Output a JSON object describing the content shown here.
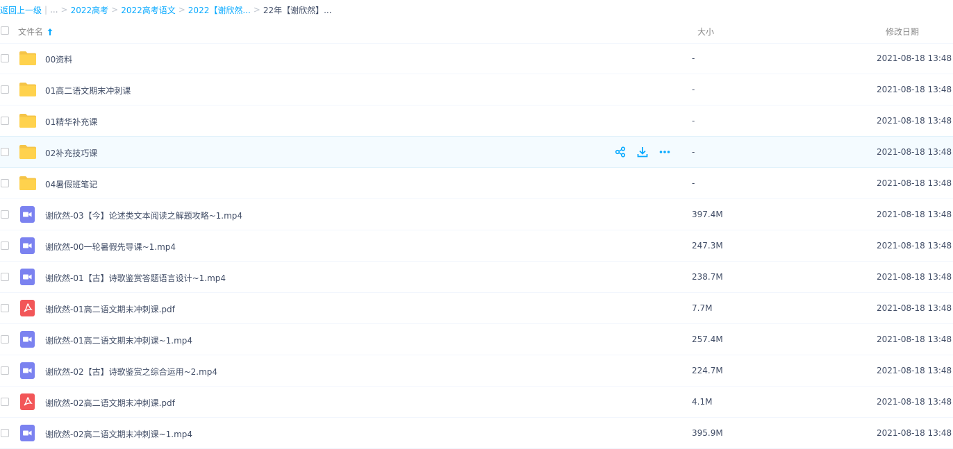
{
  "breadcrumb": {
    "back": "返回上一级",
    "ellipsis": "...",
    "crumbs": [
      "2022高考",
      "2022高考语文",
      "2022【谢欣然..."
    ],
    "current": "22年【谢欣然】..."
  },
  "header": {
    "name": "文件名",
    "size": "大小",
    "date": "修改日期"
  },
  "colors": {
    "accent": "#09aaff",
    "folder": "#ffd24d",
    "video": "#7b82f0",
    "pdf": "#f25658"
  },
  "files": [
    {
      "name": "00资料",
      "type": "folder",
      "size": "-",
      "date": "2021-08-18 13:48"
    },
    {
      "name": "01高二语文期末冲刺课",
      "type": "folder",
      "size": "-",
      "date": "2021-08-18 13:48"
    },
    {
      "name": "01精华补充课",
      "type": "folder",
      "size": "-",
      "date": "2021-08-18 13:48"
    },
    {
      "name": "02补充技巧课",
      "type": "folder",
      "size": "-",
      "date": "2021-08-18 13:48"
    },
    {
      "name": "04暑假班笔记",
      "type": "folder",
      "size": "-",
      "date": "2021-08-18 13:48"
    },
    {
      "name": " 谢欣然-03【今】论述类文本阅读之解题攻略~1.mp4",
      "type": "video",
      "size": "397.4M",
      "date": "2021-08-18 13:48"
    },
    {
      "name": "谢欣然-00一轮暑假先导课~1.mp4",
      "type": "video",
      "size": "247.3M",
      "date": "2021-08-18 13:48"
    },
    {
      "name": "谢欣然-01【古】诗歌鉴赏答题语言设计~1.mp4",
      "type": "video",
      "size": "238.7M",
      "date": "2021-08-18 13:48"
    },
    {
      "name": "谢欣然-01高二语文期末冲刺课.pdf",
      "type": "pdf",
      "size": "7.7M",
      "date": "2021-08-18 13:48"
    },
    {
      "name": "谢欣然-01高二语文期末冲刺课~1.mp4",
      "type": "video",
      "size": "257.4M",
      "date": "2021-08-18 13:48"
    },
    {
      "name": "谢欣然-02【古】诗歌鉴赏之综合运用~2.mp4",
      "type": "video",
      "size": "224.7M",
      "date": "2021-08-18 13:48"
    },
    {
      "name": "谢欣然-02高二语文期末冲刺课.pdf",
      "type": "pdf",
      "size": "4.1M",
      "date": "2021-08-18 13:48"
    },
    {
      "name": "谢欣然-02高二语文期末冲刺课~1.mp4",
      "type": "video",
      "size": "395.9M",
      "date": "2021-08-18 13:48"
    }
  ],
  "hover_row_index": 3,
  "hover_actions": [
    "share-icon",
    "download-icon",
    "more-icon"
  ]
}
